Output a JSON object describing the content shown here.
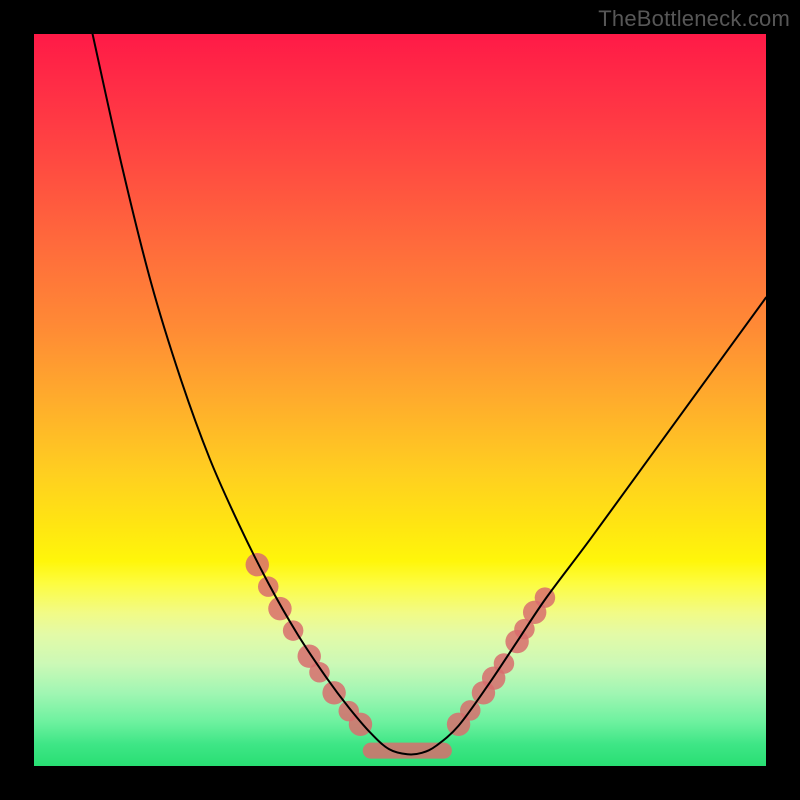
{
  "watermark": {
    "text": "TheBottleneck.com"
  },
  "chart_data": {
    "type": "line",
    "title": "",
    "xlabel": "",
    "ylabel": "",
    "xlim": [
      0,
      100
    ],
    "ylim": [
      0,
      100
    ],
    "grid": false,
    "legend": false,
    "note": "Values read from shape against 732×732 plot area; x,y normalized to 0–100. y=0 is top (red), y=100 is bottom (green).",
    "series": [
      {
        "name": "curve",
        "x": [
          8,
          12,
          16,
          20,
          24,
          28,
          32,
          36,
          40,
          43,
          46,
          48.5,
          51,
          53,
          55,
          58,
          62,
          66,
          70,
          76,
          84,
          92,
          100
        ],
        "y": [
          0,
          18,
          34,
          47,
          58,
          67,
          75,
          82,
          88,
          92,
          95.5,
          97.7,
          98.4,
          98.2,
          97.2,
          94.5,
          89,
          83,
          77,
          69,
          58,
          47,
          36
        ]
      }
    ],
    "markers": {
      "name": "highlighted-points",
      "note": "pink bump markers near curve minimum",
      "points": [
        {
          "x": 30.5,
          "y": 72.5,
          "r": 1.6
        },
        {
          "x": 32.0,
          "y": 75.5,
          "r": 1.4
        },
        {
          "x": 33.6,
          "y": 78.5,
          "r": 1.6
        },
        {
          "x": 35.4,
          "y": 81.5,
          "r": 1.4
        },
        {
          "x": 37.6,
          "y": 85.0,
          "r": 1.6
        },
        {
          "x": 39.0,
          "y": 87.2,
          "r": 1.4
        },
        {
          "x": 41.0,
          "y": 90.0,
          "r": 1.6
        },
        {
          "x": 43.0,
          "y": 92.5,
          "r": 1.4
        },
        {
          "x": 44.6,
          "y": 94.3,
          "r": 1.6
        },
        {
          "x": 58.0,
          "y": 94.3,
          "r": 1.6
        },
        {
          "x": 59.6,
          "y": 92.4,
          "r": 1.4
        },
        {
          "x": 61.4,
          "y": 90.0,
          "r": 1.6
        },
        {
          "x": 62.8,
          "y": 88.0,
          "r": 1.6
        },
        {
          "x": 64.2,
          "y": 86.0,
          "r": 1.4
        },
        {
          "x": 66.0,
          "y": 83.0,
          "r": 1.6
        },
        {
          "x": 67.0,
          "y": 81.3,
          "r": 1.4
        },
        {
          "x": 68.4,
          "y": 79.0,
          "r": 1.6
        },
        {
          "x": 69.8,
          "y": 77.0,
          "r": 1.4
        }
      ],
      "flat_segment": {
        "x0": 46.0,
        "x1": 56.0,
        "y": 97.9
      }
    }
  }
}
